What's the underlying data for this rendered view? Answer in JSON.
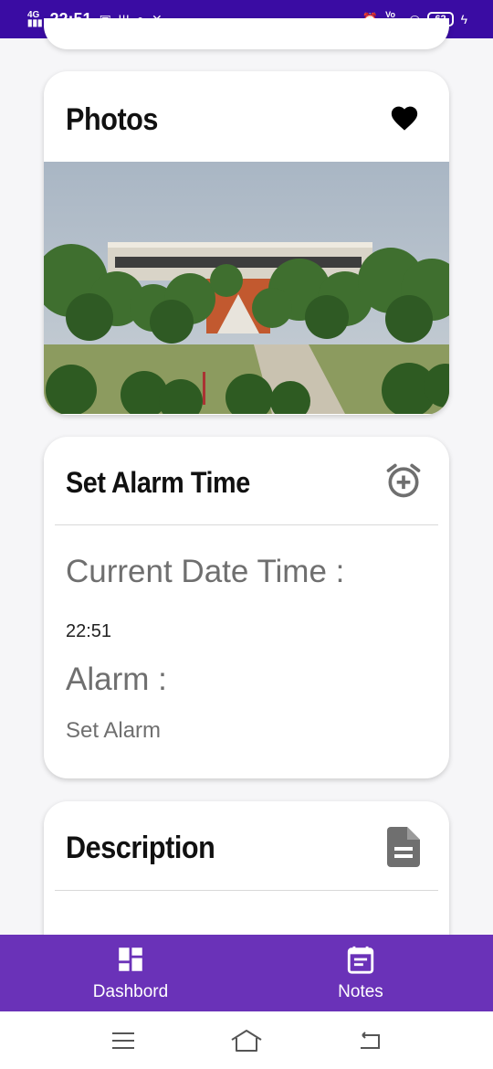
{
  "status_bar": {
    "network": "4G",
    "time": "22:51",
    "volte": "Vo LTE",
    "battery": "62"
  },
  "photos_card": {
    "title": "Photos",
    "icon": "heart-icon"
  },
  "alarm_card": {
    "title": "Set Alarm Time",
    "icon": "alarm-add-icon",
    "current_label": "Current Date Time :",
    "current_value": "22:51",
    "alarm_label": "Alarm :",
    "alarm_value": "Set Alarm"
  },
  "description_card": {
    "title": "Description",
    "icon": "document-icon"
  },
  "bottom_nav": {
    "items": [
      {
        "label": "Dashbord",
        "icon": "dashboard-icon"
      },
      {
        "label": "Notes",
        "icon": "calendar-note-icon"
      }
    ]
  },
  "colors": {
    "status_bar": "#3a0ca3",
    "nav_bar": "#6a32b8",
    "heart": "#000000",
    "muted_icon": "#6f6f6f"
  }
}
